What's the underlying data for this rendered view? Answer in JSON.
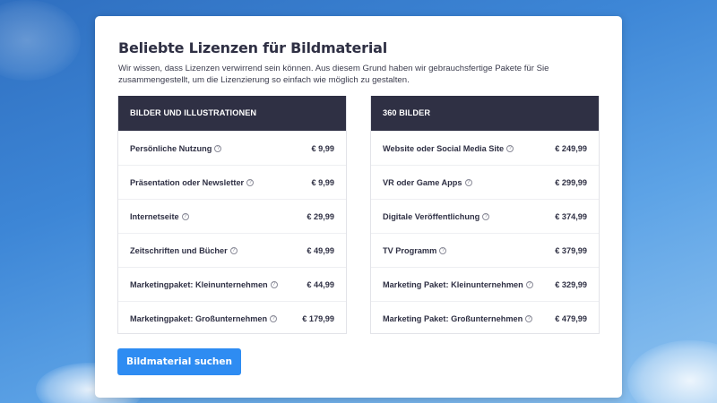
{
  "heading": "Beliebte Lizenzen für Bildmaterial",
  "description": "Wir wissen, dass Lizenzen verwirrend sein können. Aus diesem Grund haben wir gebrauchsfertige Pakete für Sie zusammengestellt, um die Lizenzierung so einfach wie möglich zu gestalten.",
  "tables": [
    {
      "header": "BILDER UND ILLUSTRATIONEN",
      "rows": [
        {
          "label": "Persönliche Nutzung",
          "price": "€ 9,99"
        },
        {
          "label": "Präsentation oder Newsletter",
          "price": "€ 9,99"
        },
        {
          "label": "Internetseite",
          "price": "€ 29,99"
        },
        {
          "label": "Zeitschriften und Bücher",
          "price": "€ 49,99"
        },
        {
          "label": "Marketingpaket: Kleinunternehmen",
          "price": "€ 44,99"
        },
        {
          "label": "Marketingpaket: Großunternehmen",
          "price": "€ 179,99"
        }
      ]
    },
    {
      "header": "360 BILDER",
      "rows": [
        {
          "label": "Website oder Social Media Site",
          "price": "€ 249,99"
        },
        {
          "label": "VR oder Game Apps",
          "price": "€ 299,99"
        },
        {
          "label": "Digitale Veröffentlichung",
          "price": "€ 374,99"
        },
        {
          "label": "TV Programm",
          "price": "€ 379,99"
        },
        {
          "label": "Marketing Paket: Kleinunternehmen",
          "price": "€ 329,99"
        },
        {
          "label": "Marketing Paket: Großunternehmen",
          "price": "€ 479,99"
        }
      ]
    }
  ],
  "help_glyph": "?",
  "icons": {
    "help": "question-circle-icon"
  },
  "cta_label": "Bildmaterial suchen",
  "colors": {
    "header_bg": "#2f3044",
    "accent": "#2e8cf2",
    "text": "#2f3044"
  }
}
